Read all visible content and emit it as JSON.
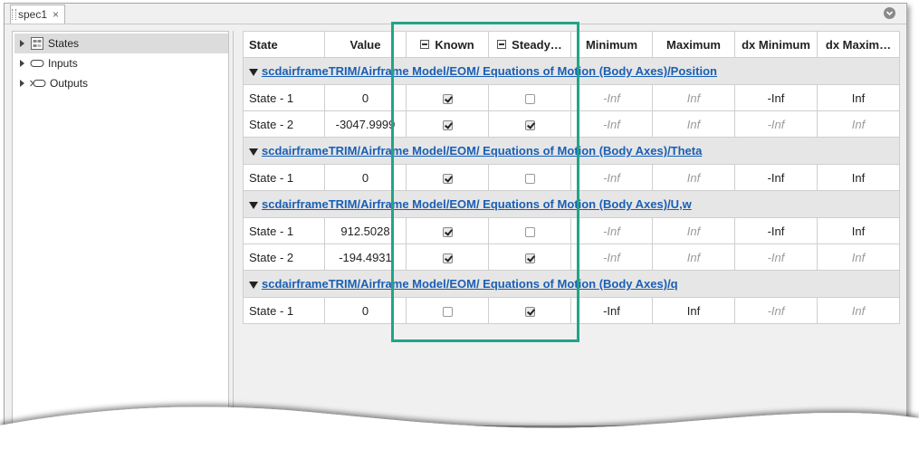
{
  "tab": {
    "title": "spec1",
    "close_glyph": "×"
  },
  "tree": {
    "items": [
      {
        "label": "States",
        "icon": "states-icon"
      },
      {
        "label": "Inputs",
        "icon": "inputs-icon"
      },
      {
        "label": "Outputs",
        "icon": "outputs-icon"
      }
    ]
  },
  "table": {
    "headers": {
      "state": "State",
      "value": "Value",
      "known": "Known",
      "steady": "Steady…",
      "minimum": "Minimum",
      "maximum": "Maximum",
      "dx_minimum": "dx Minimum",
      "dx_maximum": "dx Maxim…"
    },
    "groups": [
      {
        "path": "scdairframeTRIM/Airframe Model/EOM/ Equations of Motion (Body Axes)/Position",
        "rows": [
          {
            "state": "State - 1",
            "value": "0",
            "known": true,
            "steady": false,
            "min": "-Inf",
            "max": "Inf",
            "dxmin": "-Inf",
            "dxmax": "Inf",
            "min_muted": true,
            "max_muted": true,
            "dxmin_muted": false,
            "dxmax_muted": false
          },
          {
            "state": "State - 2",
            "value": "-3047.9999",
            "known": true,
            "steady": true,
            "min": "-Inf",
            "max": "Inf",
            "dxmin": "-Inf",
            "dxmax": "Inf",
            "min_muted": true,
            "max_muted": true,
            "dxmin_muted": true,
            "dxmax_muted": true
          }
        ]
      },
      {
        "path": "scdairframeTRIM/Airframe Model/EOM/ Equations of Motion (Body Axes)/Theta",
        "rows": [
          {
            "state": "State - 1",
            "value": "0",
            "known": true,
            "steady": false,
            "min": "-Inf",
            "max": "Inf",
            "dxmin": "-Inf",
            "dxmax": "Inf",
            "min_muted": true,
            "max_muted": true,
            "dxmin_muted": false,
            "dxmax_muted": false
          }
        ]
      },
      {
        "path": "scdairframeTRIM/Airframe Model/EOM/ Equations of Motion (Body Axes)/U,w",
        "rows": [
          {
            "state": "State - 1",
            "value": "912.5028",
            "known": true,
            "steady": false,
            "min": "-Inf",
            "max": "Inf",
            "dxmin": "-Inf",
            "dxmax": "Inf",
            "min_muted": true,
            "max_muted": true,
            "dxmin_muted": false,
            "dxmax_muted": false
          },
          {
            "state": "State - 2",
            "value": "-194.4931",
            "known": true,
            "steady": true,
            "min": "-Inf",
            "max": "Inf",
            "dxmin": "-Inf",
            "dxmax": "Inf",
            "min_muted": true,
            "max_muted": true,
            "dxmin_muted": true,
            "dxmax_muted": true
          }
        ]
      },
      {
        "path": "scdairframeTRIM/Airframe Model/EOM/ Equations of Motion (Body Axes)/q",
        "rows": [
          {
            "state": "State - 1",
            "value": "0",
            "known": false,
            "steady": true,
            "min": "-Inf",
            "max": "Inf",
            "dxmin": "-Inf",
            "dxmax": "Inf",
            "min_muted": false,
            "max_muted": false,
            "dxmin_muted": true,
            "dxmax_muted": true
          }
        ]
      }
    ]
  },
  "colors": {
    "highlight": "#1fa587",
    "link": "#1a5fb4",
    "group_bg": "#e6e6e6",
    "muted_text": "#9a9a9a"
  }
}
